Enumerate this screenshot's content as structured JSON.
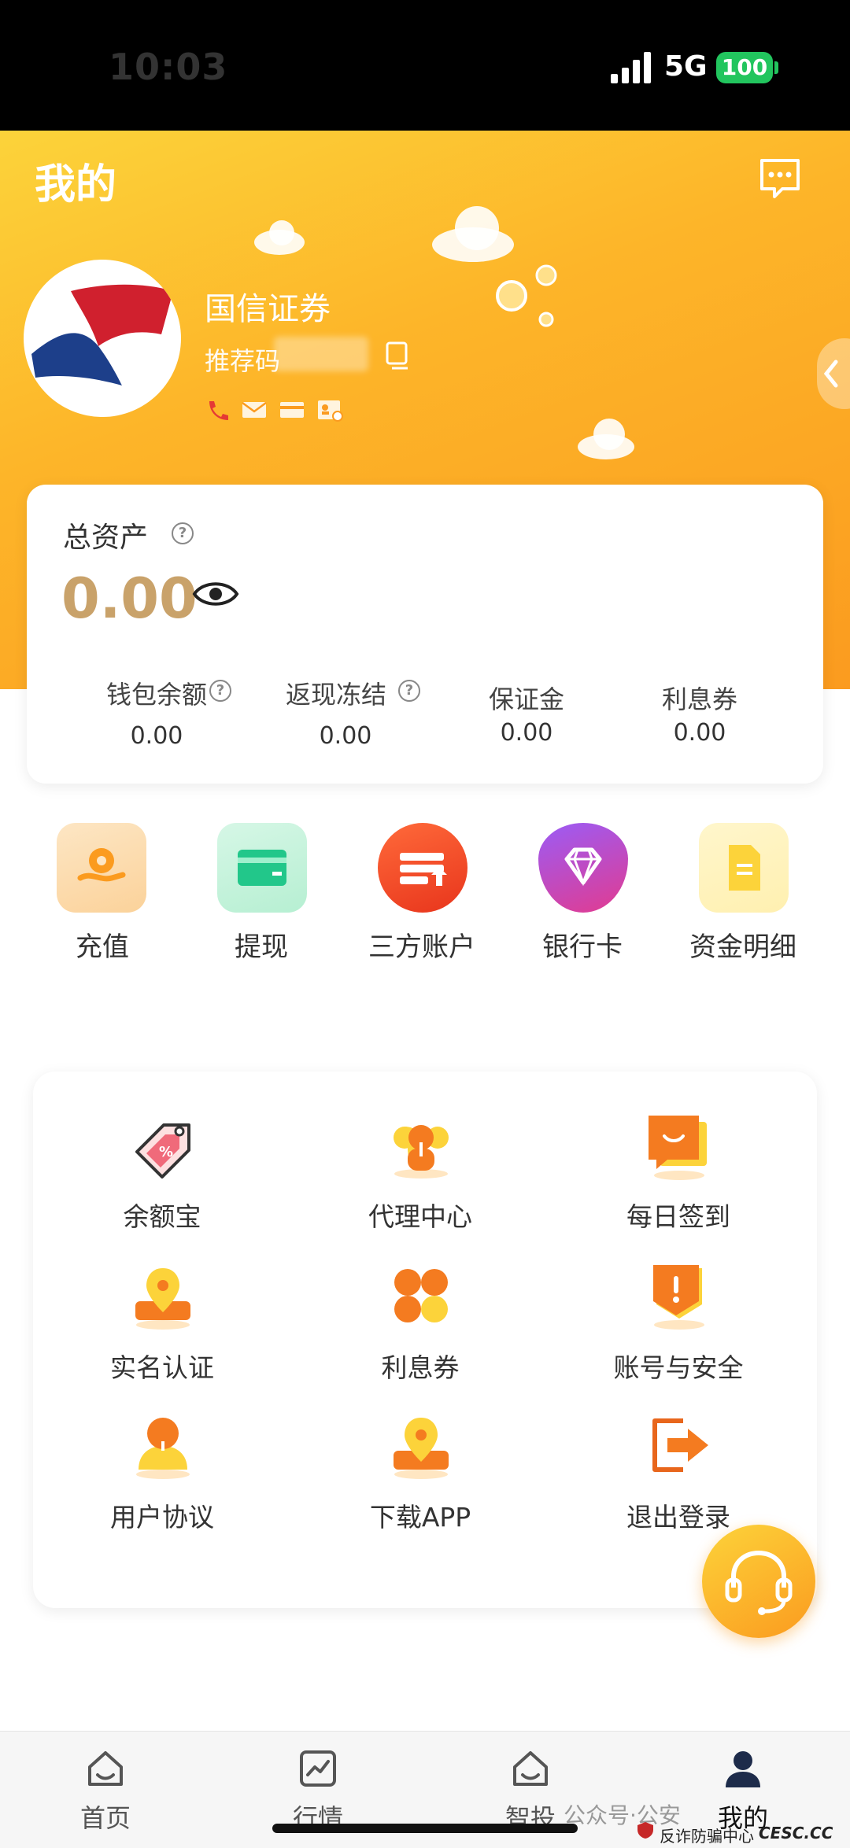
{
  "status_bar": {
    "time": "10:03",
    "network": "5G",
    "battery": "100"
  },
  "header": {
    "title": "我的",
    "company": "国信证券",
    "referral": "推荐码"
  },
  "assets": {
    "label": "总资产",
    "value": "0.00",
    "items": [
      {
        "label": "钱包余额",
        "value": "0.00"
      },
      {
        "label": "返现冻结",
        "value": "0.00"
      },
      {
        "label": "保证金",
        "value": "0.00"
      },
      {
        "label": "利息券",
        "value": "0.00"
      }
    ]
  },
  "quick_actions": [
    {
      "label": "充值",
      "icon": "recharge-icon"
    },
    {
      "label": "提现",
      "icon": "withdraw-icon"
    },
    {
      "label": "三方账户",
      "icon": "third-party-account-icon"
    },
    {
      "label": "银行卡",
      "icon": "bank-card-icon"
    },
    {
      "label": "资金明细",
      "icon": "fund-details-icon"
    }
  ],
  "menu": [
    {
      "label": "余额宝",
      "icon": "tag-icon"
    },
    {
      "label": "代理中心",
      "icon": "agent-icon"
    },
    {
      "label": "每日签到",
      "icon": "checkin-icon"
    },
    {
      "label": "实名认证",
      "icon": "location-pin-icon"
    },
    {
      "label": "利息券",
      "icon": "grid-icon"
    },
    {
      "label": "账号与安全",
      "icon": "shield-icon"
    },
    {
      "label": "用户协议",
      "icon": "user-icon"
    },
    {
      "label": "下载APP",
      "icon": "download-pin-icon"
    },
    {
      "label": "退出登录",
      "icon": "logout-icon"
    }
  ],
  "tabs": [
    {
      "label": "首页",
      "icon": "home-icon"
    },
    {
      "label": "行情",
      "icon": "chart-icon"
    },
    {
      "label": "智投",
      "icon": "smart-invest-icon"
    },
    {
      "label": "我的",
      "icon": "profile-icon"
    }
  ],
  "watermark": {
    "text1": "公众号·公安",
    "text2": "反诈防骗中心",
    "text3": "CESC.CC"
  },
  "colors": {
    "accent": "#fb9b1f",
    "asset_value": "#c9a26a",
    "brand_red": "#d0202e",
    "brand_blue": "#1d3f8a"
  }
}
